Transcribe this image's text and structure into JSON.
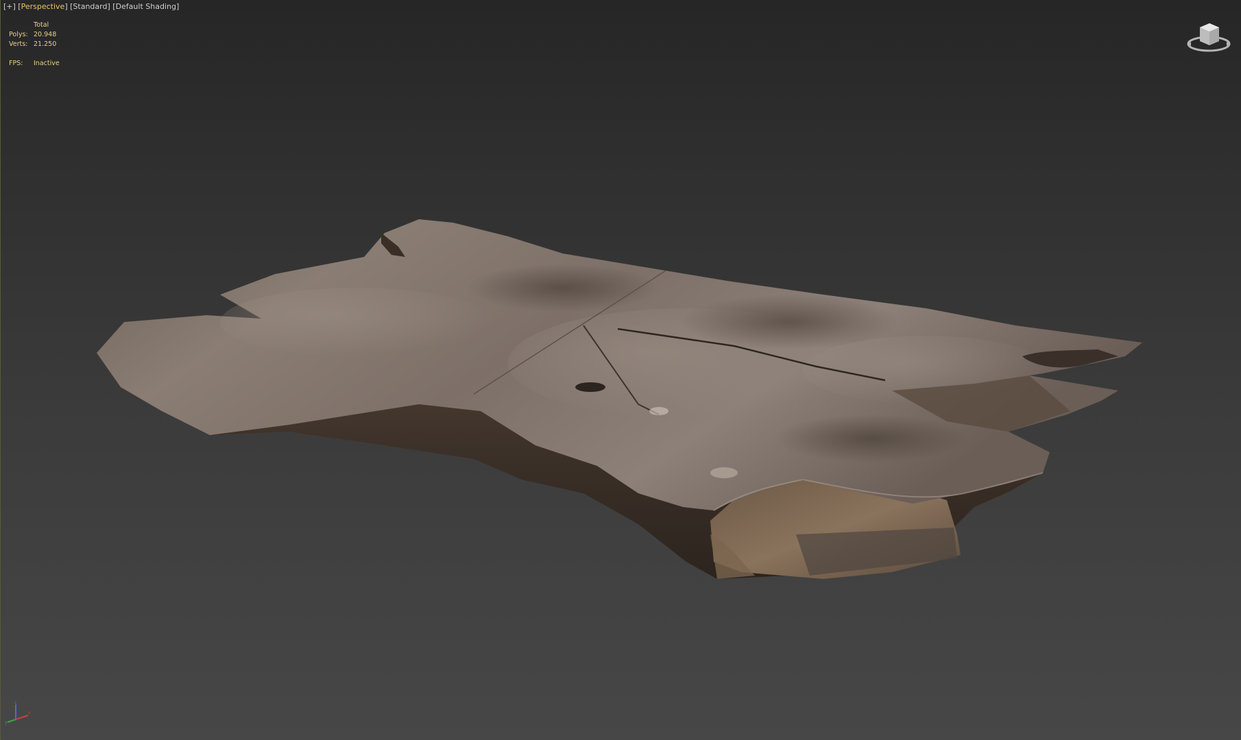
{
  "viewport": {
    "labels": {
      "plus": "+",
      "view": "Perspective",
      "camera": "Standard",
      "shading": "Default Shading"
    },
    "stats": {
      "header": "Total",
      "polys_label": "Polys:",
      "polys_value": "20.948",
      "verts_label": "Verts:",
      "verts_value": "21.250",
      "fps_label": "FPS:",
      "fps_value": "Inactive"
    },
    "colors": {
      "active_label": "#e6c56a",
      "stats_text": "#e8d18a",
      "background_top": "#262626",
      "background_bottom": "#474747"
    },
    "icons": {
      "viewcube": "viewcube-icon",
      "axis": "axis-tripod-icon"
    },
    "scene_object": "wooden slab"
  }
}
